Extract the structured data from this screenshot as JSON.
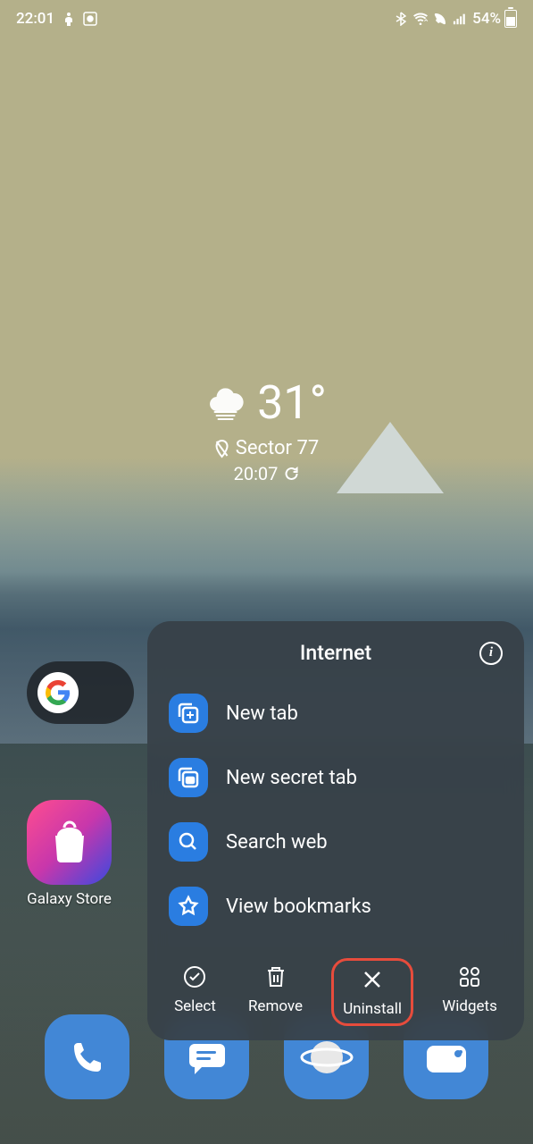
{
  "status_bar": {
    "time": "22:01",
    "battery_percent": "54%"
  },
  "weather": {
    "temperature": "31°",
    "location": "Sector 77",
    "time": "20:07"
  },
  "galaxy_store": {
    "label": "Galaxy Store"
  },
  "context_menu": {
    "title": "Internet",
    "shortcuts": [
      {
        "label": "New tab"
      },
      {
        "label": "New secret tab"
      },
      {
        "label": "Search web"
      },
      {
        "label": "View bookmarks"
      }
    ],
    "actions": [
      {
        "label": "Select"
      },
      {
        "label": "Remove"
      },
      {
        "label": "Uninstall"
      },
      {
        "label": "Widgets"
      }
    ]
  }
}
